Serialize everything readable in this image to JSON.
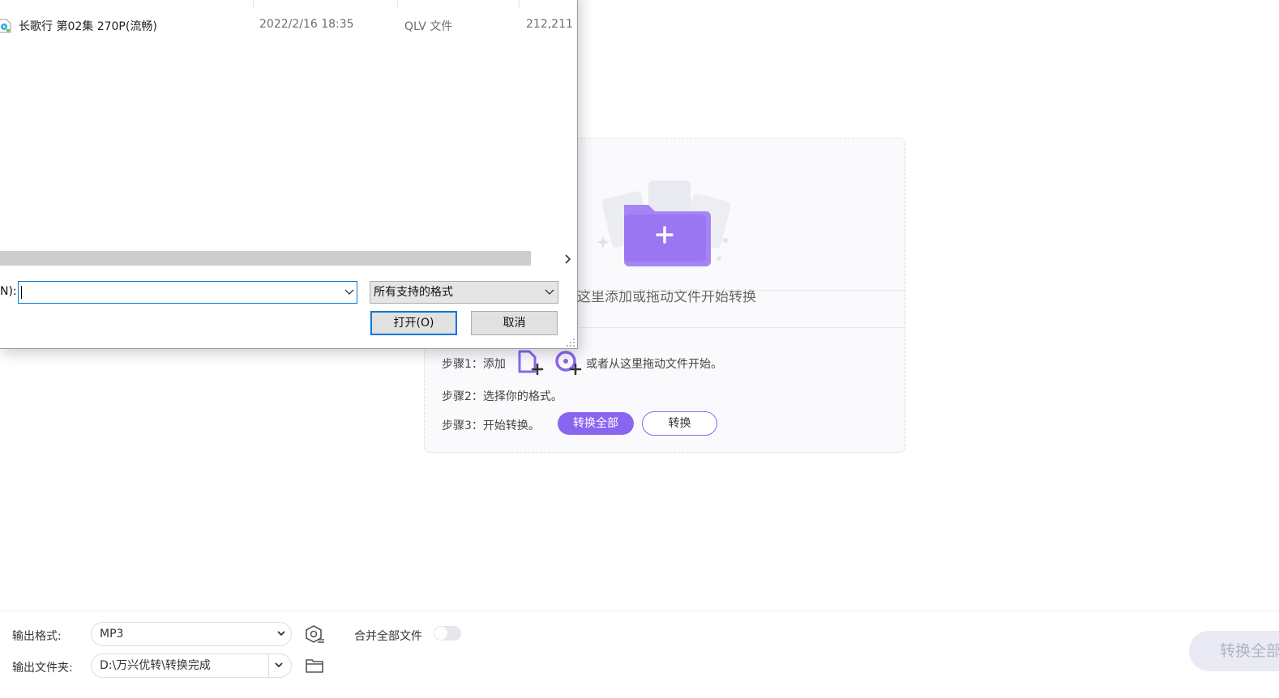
{
  "dropzone": {
    "hint": "这里添加或拖动文件开始转换",
    "step1_label": "步骤1：添加",
    "step1_suffix": "或者从这里拖动文件开始。",
    "step2_label": "步骤2：选择你的格式。",
    "step3_label": "步骤3：开始转换。",
    "convert_all_pill": "转换全部",
    "convert_pill": "转换",
    "accent_color": "#8a66f0"
  },
  "bottom": {
    "output_format_label": "输出格式:",
    "output_format_value": "MP3",
    "merge_label": "合并全部文件",
    "merge_enabled": false,
    "output_folder_label": "输出文件夹:",
    "output_folder_value": "D:\\万兴优转\\转换完成",
    "convert_all_button": "转换全部"
  },
  "dialog": {
    "files": [
      {
        "name": "长歌行 第02集 270P(流畅)",
        "modified": "2022/2/16 18:35",
        "type": "QLV 文件",
        "size": "212,211"
      }
    ],
    "filename_label": "N):",
    "filename_value": "",
    "filetype_value": "所有支持的格式",
    "open_button": "打开(O)",
    "cancel_button": "取消"
  }
}
